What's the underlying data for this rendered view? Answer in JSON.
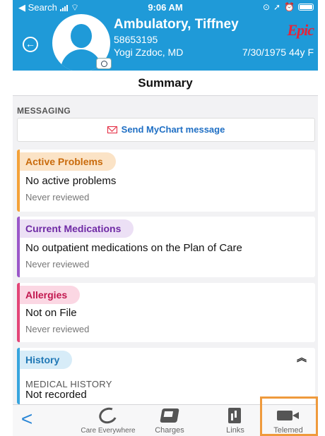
{
  "status_bar": {
    "back_app": "◀ Search",
    "time": "9:06 AM"
  },
  "patient": {
    "name": "Ambulatory, Tiffney",
    "mrn": "58653195",
    "provider": "Yogi Zzdoc, MD",
    "dob_age": "7/30/1975 44y F"
  },
  "brand": "Epic",
  "page_title": "Summary",
  "messaging": {
    "label": "MESSAGING",
    "button": "Send MyChart message"
  },
  "cards": {
    "problems": {
      "title": "Active Problems",
      "value": "No active problems",
      "reviewed": "Never reviewed"
    },
    "medications": {
      "title": "Current Medications",
      "value": "No outpatient medications on the Plan of Care",
      "reviewed": "Never reviewed"
    },
    "allergies": {
      "title": "Allergies",
      "value": "Not on File",
      "reviewed": "Never reviewed"
    },
    "history": {
      "title": "History",
      "subheading": "MEDICAL HISTORY",
      "value": "Not recorded"
    }
  },
  "tabbar": {
    "back": "<",
    "care_everywhere": "Care Everywhere",
    "charges": "Charges",
    "links": "Links",
    "telemed": "Telemed"
  },
  "colors": {
    "header": "#1f9ad8",
    "problems": "#f4a23a",
    "medications": "#9b58c9",
    "allergies": "#e34678",
    "history": "#38a5de",
    "highlight": "#ef9a3c"
  }
}
